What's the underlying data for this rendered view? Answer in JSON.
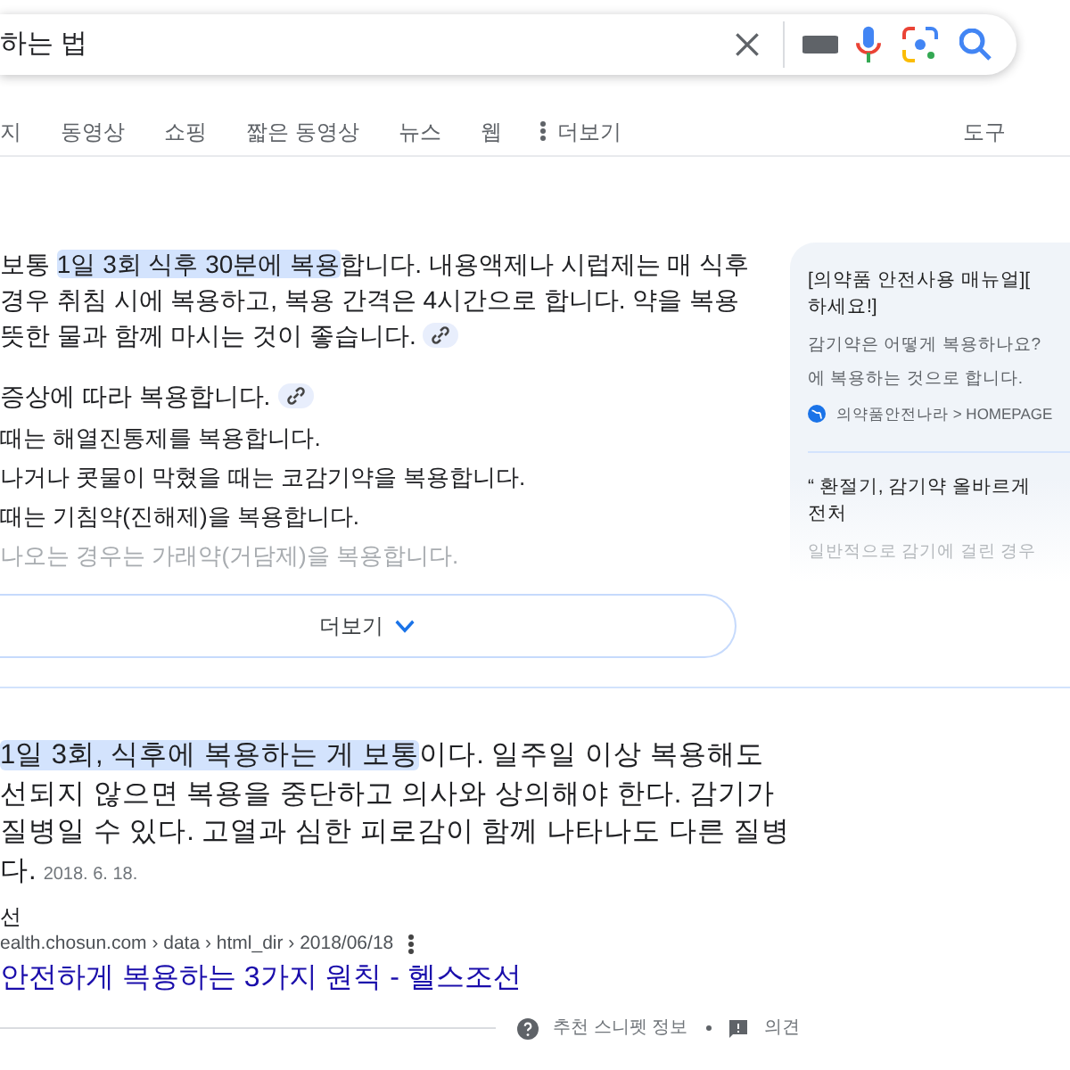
{
  "search": {
    "query": "하는 법"
  },
  "tabs": [
    {
      "label": "지",
      "kind": "tab"
    },
    {
      "label": "동영상",
      "kind": "tab"
    },
    {
      "label": "쇼핑",
      "kind": "tab"
    },
    {
      "label": "짧은 동영상",
      "kind": "tab"
    },
    {
      "label": "뉴스",
      "kind": "tab"
    },
    {
      "label": "웹",
      "kind": "tab"
    },
    {
      "label": "더보기",
      "kind": "more"
    }
  ],
  "tools": "도구",
  "snippet": {
    "paragraphs": [
      {
        "before": "보통 ",
        "highlight": "1일 3회 식후 30분에 복용",
        "after": "합니다. 내용액제나 시럽제는 매 식후"
      },
      {
        "before": "경우 취침 시에 복용하고, 복용 간격은 4시간으로 합니다. 약을 복용"
      },
      {
        "link": true,
        "before": "뜻한 물과 함께 마시는 것이 좋습니다."
      },
      {
        "link": true,
        "before": "증상에 따라 복용합니다."
      }
    ],
    "list": [
      {
        "text": "때는 해열진통제를 복용합니다.",
        "faded": false
      },
      {
        "text": "나거나 콧물이 막혔을 때는 코감기약을 복용합니다.",
        "faded": false
      },
      {
        "text": "때는 기침약(진해제)을 복용합니다.",
        "faded": false
      },
      {
        "text": "나오는 경우는 가래약(거담제)을 복용합니다.",
        "faded": true
      }
    ],
    "more_button": "더보기"
  },
  "side_panel": {
    "items": [
      {
        "title_lines": [
          "[의약품 안전사용 매뉴얼][",
          "하세요!]"
        ],
        "snippet_lines": [
          "감기약은 어떻게 복용하나요?",
          "에 복용하는 것으로 합니다."
        ],
        "source": "의약품안전나라 > HOMEPAGE"
      },
      {
        "title_lines": [
          "“ 환절기, 감기약 올바르게",
          "전처"
        ],
        "snippet_lines": [
          "일반적으로 감기에 걸린 경우"
        ]
      }
    ]
  },
  "result": {
    "lines": [
      {
        "highlight": "1일 3회, 식후에 복용하는 게 보통",
        "after": "이다. 일주일 이상 복용해도"
      },
      {
        "before": "선되지 않으면 복용을 중단하고 의사와 상의해야 한다. 감기가"
      },
      {
        "before": "질병일 수 있다. 고열과 심한 피로감이 함께 나타나도 다른 질병"
      },
      {
        "before": "다."
      }
    ],
    "date": "2018. 6. 18.",
    "site": "선",
    "url": "ealth.chosun.com › data › html_dir › 2018/06/18",
    "title": "안전하게 복용하는 3가지 원칙 - 헬스조선"
  },
  "footer": {
    "about": "추천 스니펫 정보",
    "feedback": "의견"
  }
}
